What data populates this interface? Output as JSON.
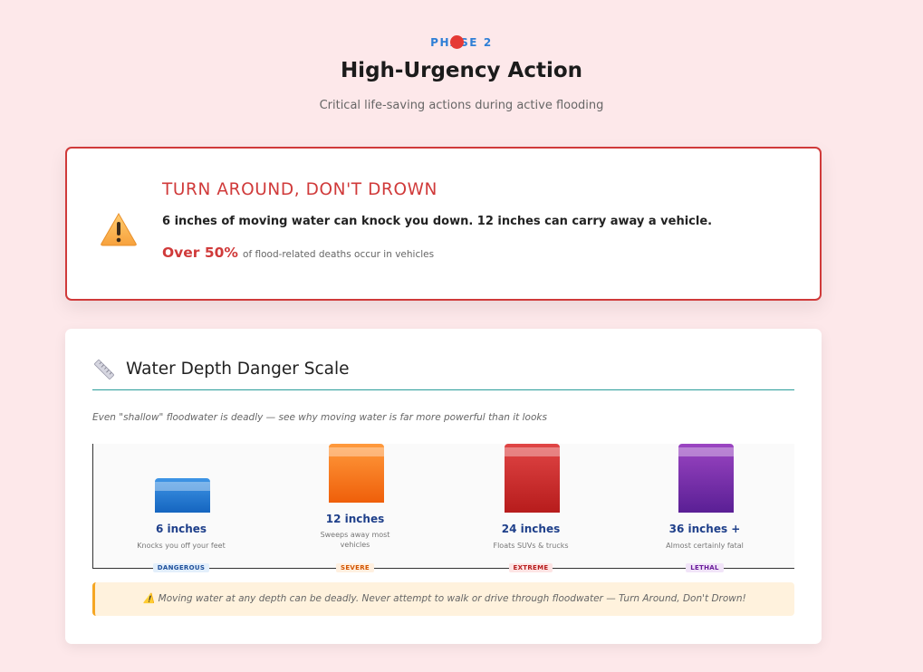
{
  "header": {
    "phase": "PHASE 2",
    "title": "High-Urgency Action",
    "subtitle": "Critical life-saving actions during active flooding"
  },
  "warning": {
    "icon": "warning-icon",
    "title": "TURN AROUND, DON'T DROWN",
    "text": "6 inches of moving water can knock you down. 12 inches can carry away a vehicle.",
    "stat_big": "Over 50%",
    "stat_small": "of flood-related deaths occur in vehicles"
  },
  "scale": {
    "icon": "ruler-icon",
    "title": "Water Depth Danger Scale",
    "description": "Even \"shallow\" floodwater is deadly — see why moving water is far more powerful than it looks",
    "levels": [
      {
        "label": "6 inches",
        "sub": "Knocks you off your feet",
        "badge": "DANGEROUS",
        "colors": [
          "#3f95e6",
          "#1565c0"
        ],
        "badge_bg": "#e3effb",
        "badge_fg": "#1e4f9a"
      },
      {
        "label": "12 inches",
        "sub": "Sweeps away most vehicles",
        "badge": "SEVERE",
        "colors": [
          "#ff9a3c",
          "#ef5f0a"
        ],
        "badge_bg": "#fff0e0",
        "badge_fg": "#d35400"
      },
      {
        "label": "24 inches",
        "sub": "Floats SUVs & trucks",
        "badge": "EXTREME",
        "colors": [
          "#e04545",
          "#b71c1c"
        ],
        "badge_bg": "#fde4e4",
        "badge_fg": "#b71c1c"
      },
      {
        "label": "36 inches +",
        "sub": "Almost certainly fatal",
        "badge": "LETHAL",
        "colors": [
          "#9b45c2",
          "#5a1f95"
        ],
        "badge_bg": "#f1e4f8",
        "badge_fg": "#6a1b9a"
      }
    ],
    "note": "⚠️ Moving water at any depth can be deadly. Never attempt to walk or drive through floodwater — Turn Around, Don't Drown!"
  }
}
